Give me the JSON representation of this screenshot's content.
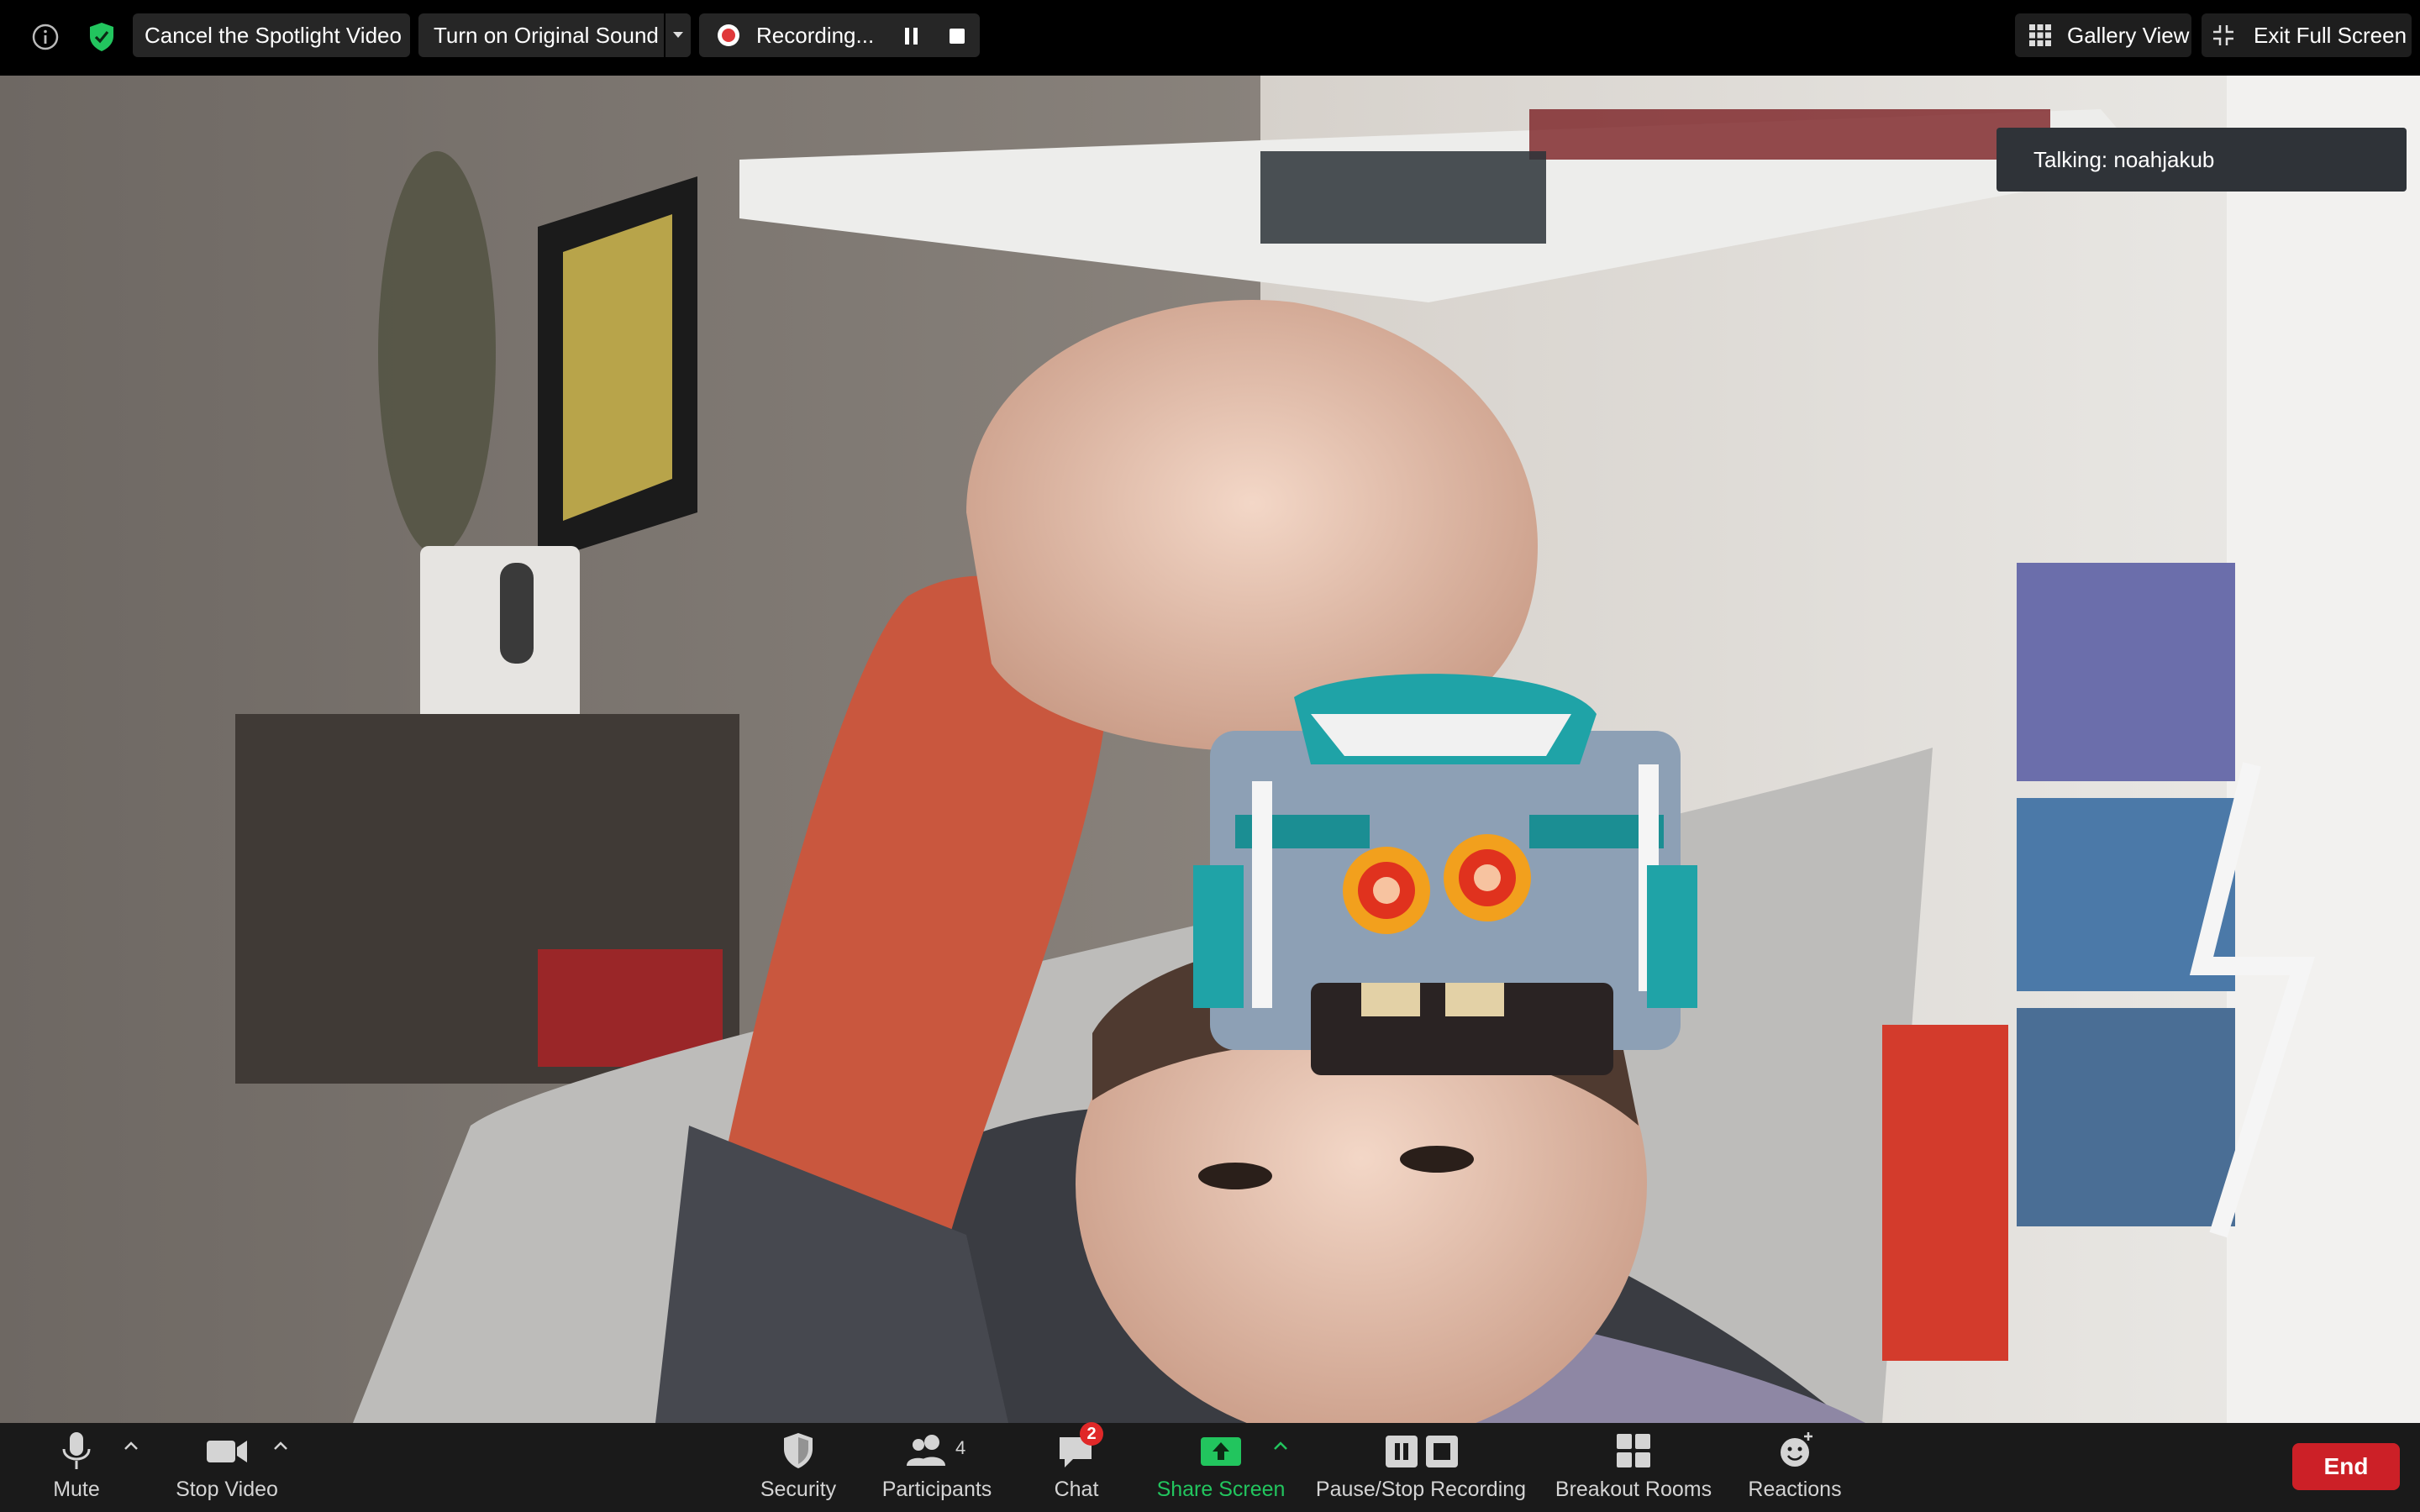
{
  "top_bar": {
    "cancel_spotlight_label": "Cancel the Spotlight Video",
    "original_sound_label": "Turn on Original Sound",
    "recording_label": "Recording...",
    "gallery_view_label": "Gallery View",
    "exit_fullscreen_label": "Exit Full Screen"
  },
  "video": {
    "talking_label": "Talking: noahjakub",
    "participant_name": "noahjakub"
  },
  "toolbar": {
    "mute_label": "Mute",
    "stop_video_label": "Stop Video",
    "security_label": "Security",
    "participants_label": "Participants",
    "participants_count": "4",
    "chat_label": "Chat",
    "chat_badge": "2",
    "share_screen_label": "Share Screen",
    "pause_stop_recording_label": "Pause/Stop Recording",
    "breakout_rooms_label": "Breakout Rooms",
    "reactions_label": "Reactions",
    "end_label": "End"
  },
  "colors": {
    "share_green": "#22c55e",
    "end_red": "#cc2027",
    "chat_badge_red": "#e02828",
    "shield_green": "#22c55e",
    "record_red": "#e0383a"
  }
}
